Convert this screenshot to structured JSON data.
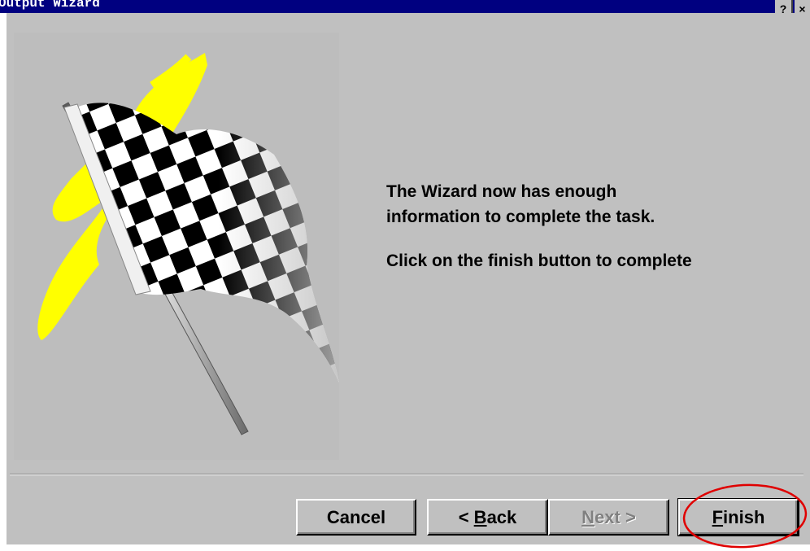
{
  "window": {
    "title": "Output Wizard",
    "help_glyph": "?",
    "close_glyph": "×"
  },
  "content": {
    "message_line1": "The Wizard now has enough",
    "message_line2": "information to complete the task.",
    "message_line3": "Click on the finish button to complete"
  },
  "buttons": {
    "cancel": "Cancel",
    "back_prefix": "< ",
    "back_accel": "B",
    "back_rest": "ack",
    "next_accel": "N",
    "next_rest": "ext >",
    "finish_accel": "F",
    "finish_rest": "inish"
  },
  "state": {
    "next_enabled": false,
    "highlighted_button": "finish"
  },
  "colors": {
    "titlebar": "#000080",
    "face": "#c0c0c0",
    "annotation": "#e00000",
    "flag_swoosh": "#ffff00"
  },
  "icons": {
    "illustration": "checkered-flag-icon"
  }
}
